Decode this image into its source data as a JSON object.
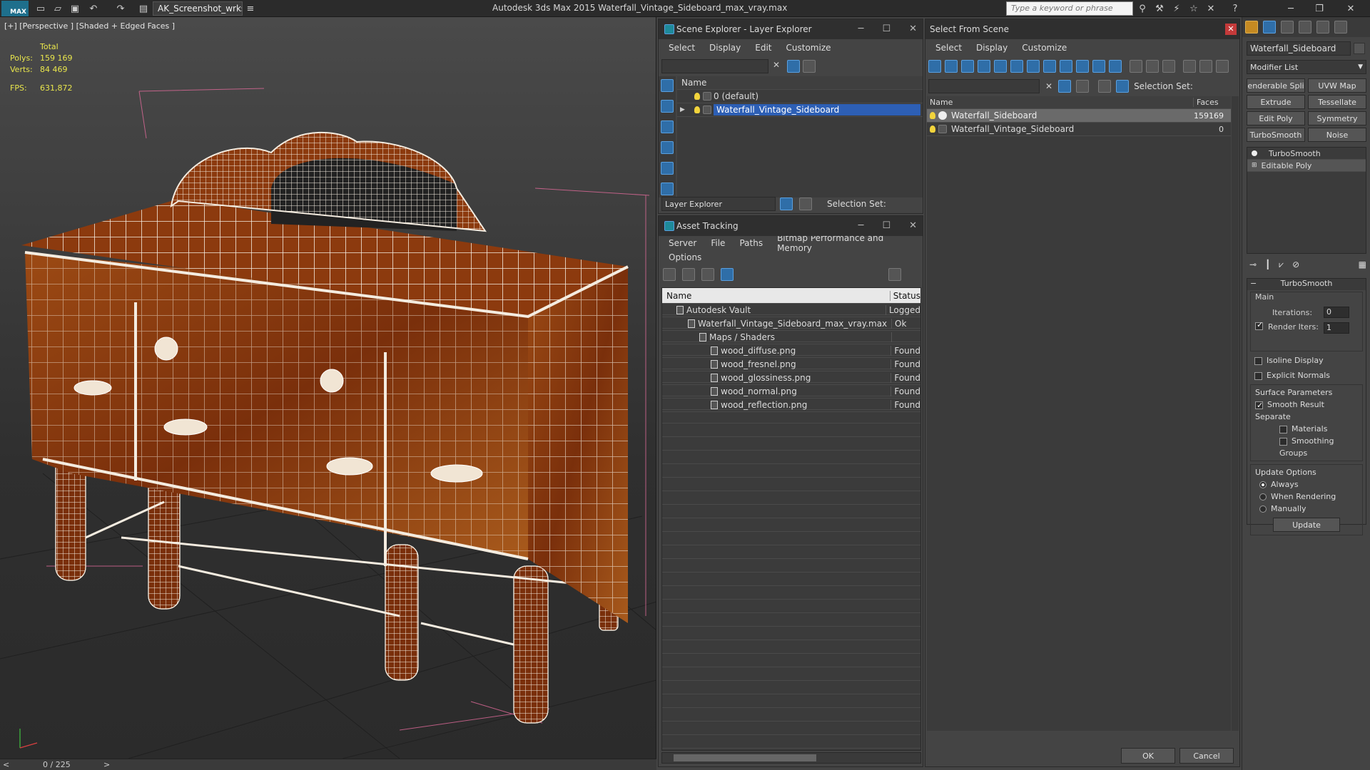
{
  "app": {
    "title": "Autodesk 3ds Max  2015     Waterfall_Vintage_Sideboard_max_vray.max",
    "logo": "MAX",
    "workspace": "AK_Screenshot_wrksp",
    "search_placeholder": "Type a keyword or phrase"
  },
  "viewport": {
    "label": "[+] [Perspective ] [Shaded + Edged Faces ]",
    "stats": {
      "total_label": "Total",
      "polys_label": "Polys:",
      "polys": "159 169",
      "verts_label": "Verts:",
      "verts": "84 469",
      "fps_label": "FPS:",
      "fps": "631,872"
    },
    "timeline": {
      "frame": "0 / 225",
      "prev": "<",
      "next": ">"
    }
  },
  "scene_explorer": {
    "title": "Scene Explorer - Layer Explorer",
    "menu": [
      "Select",
      "Display",
      "Edit",
      "Customize"
    ],
    "col_name": "Name",
    "rows": [
      "0 (default)",
      "Waterfall_Vintage_Sideboard"
    ],
    "footer_dropdown": "Layer Explorer",
    "selection_set": "Selection Set:"
  },
  "asset_tracking": {
    "title": "Asset Tracking",
    "menu": [
      "Server",
      "File",
      "Paths",
      "Bitmap Performance and Memory"
    ],
    "menu2": "Options",
    "col_name": "Name",
    "col_status": "Status",
    "rows": [
      {
        "name": "Autodesk Vault",
        "status": "Logged",
        "indent": 0
      },
      {
        "name": "Waterfall_Vintage_Sideboard_max_vray.max",
        "status": "Ok",
        "indent": 1
      },
      {
        "name": "Maps / Shaders",
        "status": "",
        "indent": 2
      },
      {
        "name": "wood_diffuse.png",
        "status": "Found",
        "indent": 3
      },
      {
        "name": "wood_fresnel.png",
        "status": "Found",
        "indent": 3
      },
      {
        "name": "wood_glossiness.png",
        "status": "Found",
        "indent": 3
      },
      {
        "name": "wood_normal.png",
        "status": "Found",
        "indent": 3
      },
      {
        "name": "wood_reflection.png",
        "status": "Found",
        "indent": 3
      }
    ]
  },
  "select_from_scene": {
    "title": "Select From Scene",
    "menu": [
      "Select",
      "Display",
      "Customize"
    ],
    "selection_set": "Selection Set:",
    "col_name": "Name",
    "col_faces": "Faces",
    "rows": [
      {
        "name": "Waterfall_Sideboard",
        "faces": "159169"
      },
      {
        "name": "Waterfall_Vintage_Sideboard",
        "faces": "0"
      }
    ],
    "ok": "OK",
    "cancel": "Cancel"
  },
  "command_panel": {
    "object_name": "Waterfall_Sideboard",
    "modifier_list": "Modifier List",
    "buttons": [
      "enderable Spli",
      "UVW Map",
      "Extrude",
      "Tessellate",
      "Edit Poly",
      "Symmetry",
      "TurboSmooth",
      "Noise"
    ],
    "stack": [
      "TurboSmooth",
      "Editable Poly"
    ],
    "rollout": "TurboSmooth",
    "main": "Main",
    "iterations_label": "Iterations:",
    "iterations": "0",
    "render_iters_label": "Render Iters:",
    "render_iters": "1",
    "isoline": "Isoline Display",
    "explicit": "Explicit Normals",
    "surface": "Surface Parameters",
    "smooth": "Smooth Result",
    "separate": "Separate",
    "materials": "Materials",
    "smoothing": "Smoothing Groups",
    "update_options": "Update Options",
    "always": "Always",
    "when_rendering": "When Rendering",
    "manually": "Manually",
    "update": "Update"
  },
  "colors": {
    "accent": "#2d5fb5",
    "wood": "#8a3a10",
    "wire": "#f4ece0"
  }
}
